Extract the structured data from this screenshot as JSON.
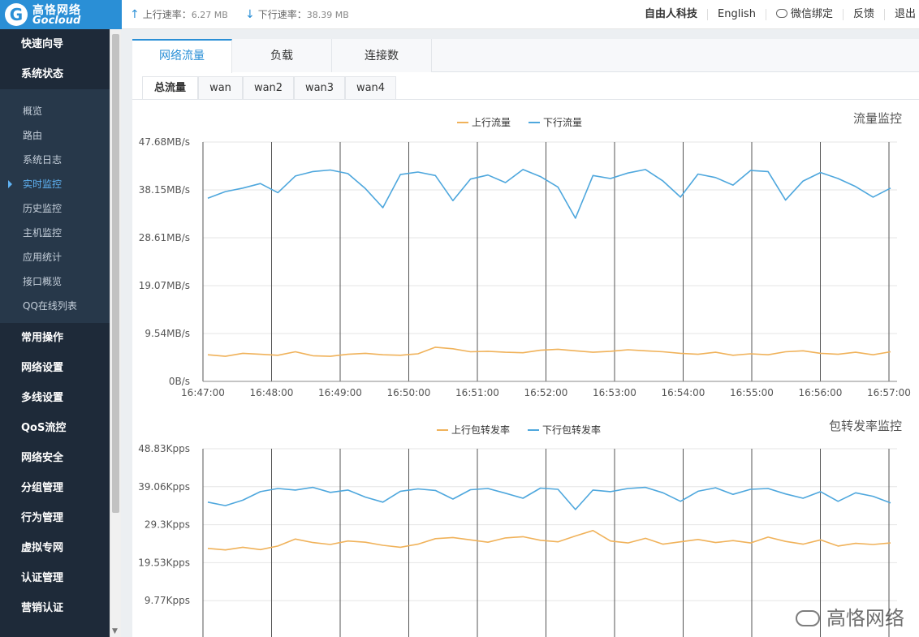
{
  "header": {
    "logo_cn": "高恪网络",
    "logo_en": "Gocloud",
    "up_rate_label": "上行速率：",
    "up_rate_value": "6.27 MB",
    "down_rate_label": "下行速率：",
    "down_rate_value": "38.39 MB",
    "links": [
      "自由人科技",
      "English",
      "微信绑定",
      "反馈",
      "退出"
    ]
  },
  "sidebar": {
    "top_items": [
      "快速向导",
      "系统状态"
    ],
    "sub_items": [
      "概览",
      "路由",
      "系统日志",
      "实时监控",
      "历史监控",
      "主机监控",
      "应用统计",
      "接口概览",
      "QQ在线列表"
    ],
    "active_sub": "实时监控",
    "bottom_items": [
      "常用操作",
      "网络设置",
      "多线设置",
      "QoS流控",
      "网络安全",
      "分组管理",
      "行为管理",
      "虚拟专网",
      "认证管理",
      "营销认证"
    ]
  },
  "tabs": [
    "网络流量",
    "负载",
    "连接数"
  ],
  "active_tab": "网络流量",
  "subtabs": [
    "总流量",
    "wan",
    "wan2",
    "wan3",
    "wan4"
  ],
  "active_subtab": "总流量",
  "colors": {
    "upload": "#f0b25a",
    "download": "#4ea7dd",
    "brand": "#2a8fd6"
  },
  "watermark": "高恪网络",
  "chart_data": [
    {
      "type": "line",
      "title": "流量监控",
      "y_ticks": [
        "47.68MB/s",
        "38.15MB/s",
        "28.61MB/s",
        "19.07MB/s",
        "9.54MB/s",
        "0B/s"
      ],
      "ylim": [
        0,
        47.68
      ],
      "x_ticks": [
        "16:47:00",
        "16:48:00",
        "16:49:00",
        "16:50:00",
        "16:51:00",
        "16:52:00",
        "16:53:00",
        "16:54:00",
        "16:55:00",
        "16:56:00",
        "16:57:00"
      ],
      "legend_position": "top-center",
      "grid": true,
      "series": [
        {
          "name": "上行流量",
          "color": "#f0b25a",
          "values": [
            5.3,
            5.0,
            5.6,
            5.4,
            5.2,
            5.9,
            5.1,
            5.0,
            5.4,
            5.6,
            5.3,
            5.2,
            5.5,
            6.8,
            6.5,
            5.9,
            6.0,
            5.8,
            5.7,
            6.2,
            6.4,
            6.1,
            5.8,
            6.0,
            6.3,
            6.1,
            5.9,
            5.6,
            5.4,
            5.8,
            5.2,
            5.5,
            5.3,
            5.9,
            6.1,
            5.6,
            5.4,
            5.8,
            5.3,
            5.9
          ],
          "bottom_series_note": ""
        },
        {
          "name": "下行流量",
          "color": "#4ea7dd",
          "values": [
            36.5,
            37.8,
            38.5,
            39.4,
            37.6,
            40.9,
            41.8,
            42.1,
            41.4,
            38.4,
            34.6,
            41.2,
            41.7,
            41.0,
            36.0,
            40.3,
            41.1,
            39.6,
            42.2,
            40.8,
            38.7,
            32.5,
            41.0,
            40.4,
            41.5,
            42.2,
            39.9,
            36.7,
            41.3,
            40.6,
            39.1,
            42.0,
            41.8,
            36.1,
            39.9,
            41.6,
            40.4,
            38.8,
            36.7,
            38.5
          ]
        }
      ]
    },
    {
      "type": "line",
      "title": "包转发率监控",
      "y_ticks": [
        "48.83Kpps",
        "39.06Kpps",
        "29.3Kpps",
        "19.53Kpps",
        "9.77Kpps"
      ],
      "ylim": [
        0,
        48.83
      ],
      "legend_position": "top-center",
      "grid": true,
      "series": [
        {
          "name": "上行包转发率",
          "color": "#f0b25a",
          "values": [
            23.2,
            22.8,
            23.5,
            22.9,
            23.8,
            25.6,
            24.7,
            24.2,
            25.1,
            24.8,
            24.0,
            23.5,
            24.3,
            25.7,
            26.0,
            25.4,
            24.8,
            25.9,
            26.2,
            25.3,
            24.9,
            26.4,
            27.8,
            25.1,
            24.6,
            25.8,
            24.3,
            24.9,
            25.5,
            24.7,
            25.2,
            24.6,
            26.1,
            25.0,
            24.3,
            25.4,
            23.8,
            24.5,
            24.2,
            24.6
          ]
        },
        {
          "name": "下行包转发率",
          "color": "#4ea7dd",
          "values": [
            35.1,
            34.2,
            35.6,
            37.8,
            38.6,
            38.2,
            38.9,
            37.6,
            38.2,
            36.4,
            35.1,
            37.9,
            38.5,
            38.1,
            35.9,
            38.3,
            38.6,
            37.4,
            36.1,
            38.7,
            38.4,
            33.2,
            38.2,
            37.8,
            38.6,
            38.9,
            37.5,
            35.3,
            37.9,
            38.8,
            37.1,
            38.4,
            38.6,
            37.2,
            36.1,
            37.8,
            35.3,
            37.5,
            36.6,
            34.9
          ]
        }
      ]
    }
  ]
}
